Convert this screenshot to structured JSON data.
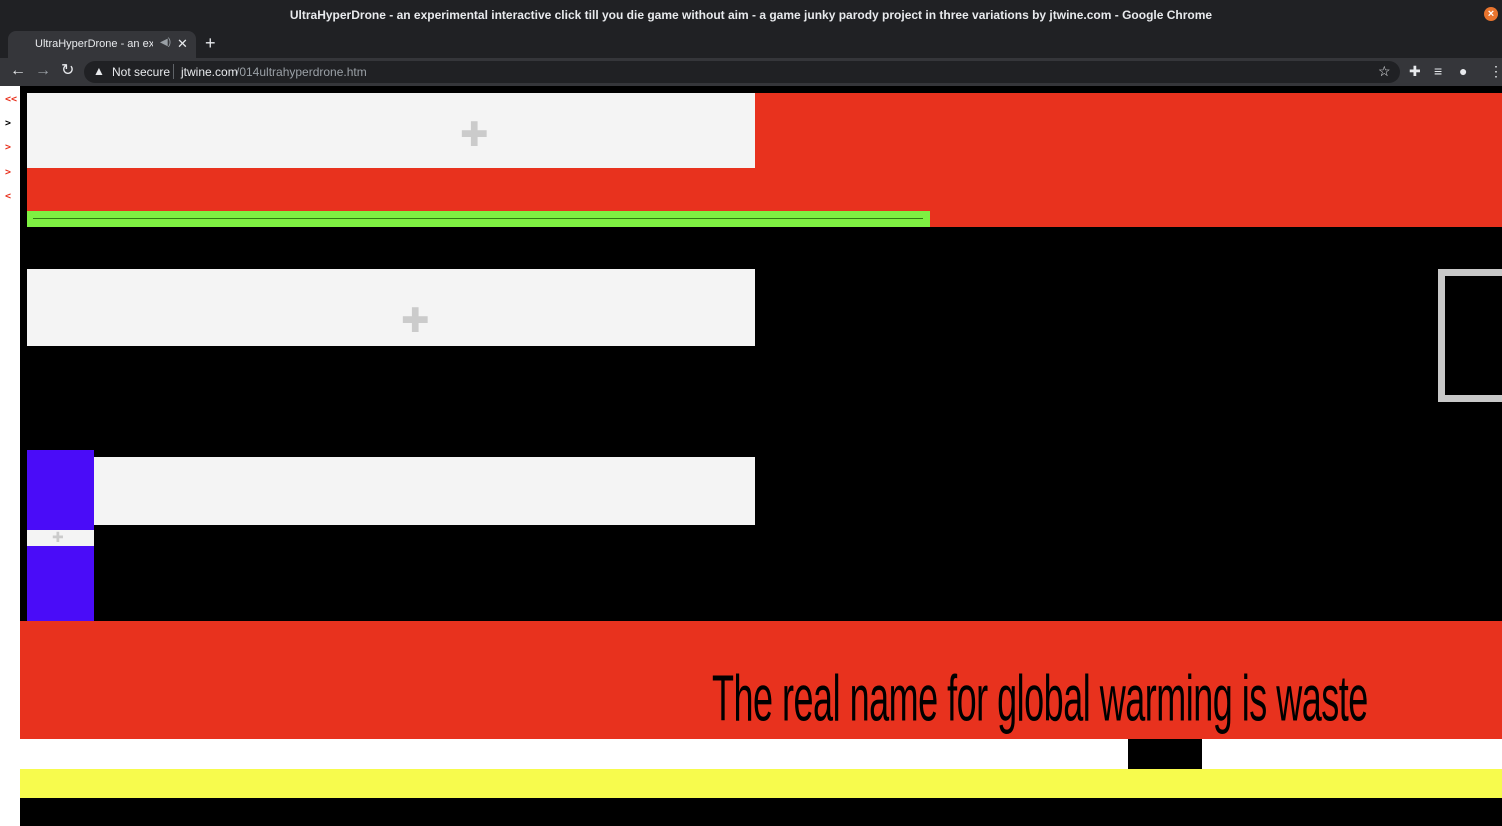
{
  "window": {
    "title": "UltraHyperDrone - an experimental interactive click till you die game without aim - a game junky parody project in three variations by jtwine.com - Google Chrome"
  },
  "tab": {
    "title": "UltraHyperDrone - an exp"
  },
  "address_bar": {
    "security_label": "Not secure",
    "host": "jtwine.com",
    "path": "/014ultrahyperdrone.htm"
  },
  "left_nav": {
    "links": [
      "<<",
      ">",
      ">",
      ">",
      "<"
    ]
  },
  "page": {
    "banner_text": "The real name for global warming is waste"
  },
  "colors": {
    "red": "#e8321e",
    "green": "#7ef042",
    "blue": "#4a0cf8",
    "yellow": "#f7fb4d",
    "plugin_placeholder": "#f4f4f4"
  },
  "icons": {
    "plugin": "puzzle-piece-icon",
    "back": "arrow-left-icon",
    "forward": "arrow-right-icon",
    "reload": "reload-icon",
    "bookmark": "star-icon",
    "extensions": "puzzle-icon",
    "media": "queue-music-icon",
    "profile": "account-icon",
    "menu": "kebab-menu-icon"
  }
}
